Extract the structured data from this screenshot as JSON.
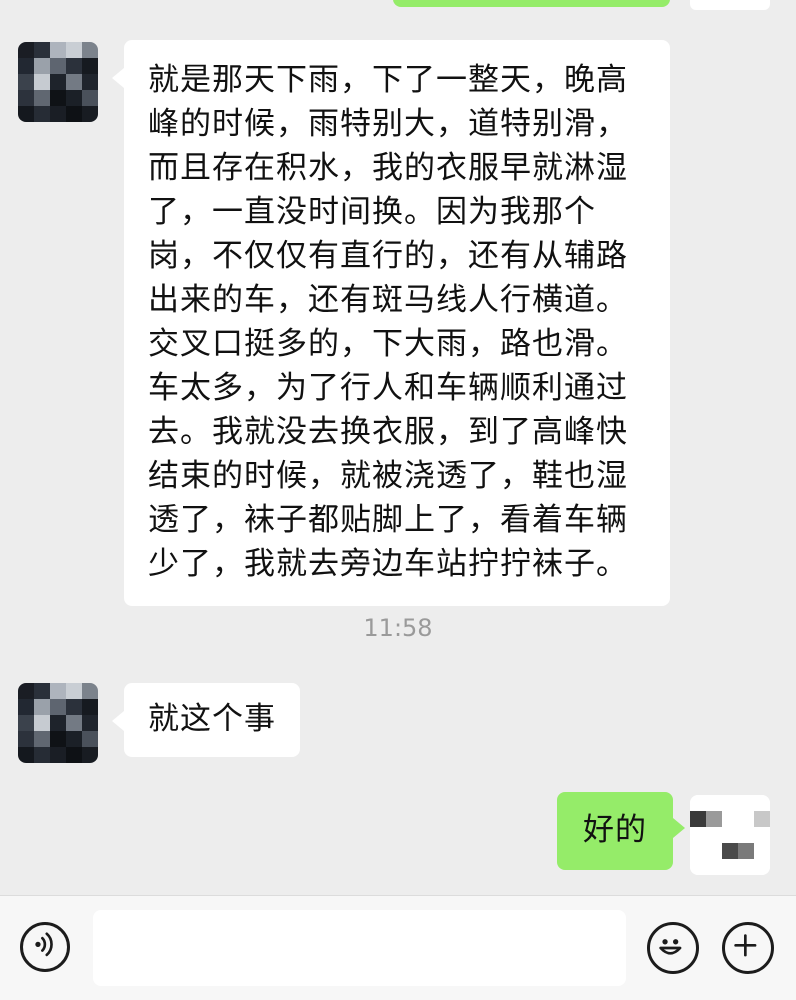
{
  "messages": [
    {
      "direction": "in",
      "lines": [
        "就是那天下雨，下了一整天，晚高",
        "峰的时候，雨特别大，道特别滑，",
        "而且存在积水，我的衣服早就淋湿",
        "了，一直没时间换。因为我那个",
        "岗，不仅仅有直行的，还有从辅路",
        "出来的车，还有斑马线人行横道。",
        "交叉口挺多的，下大雨，路也滑。",
        "车太多，为了行人和车辆顺利通过",
        "去。我就没去换衣服，到了高峰快",
        "结束的时候，就被浇透了，鞋也湿",
        "透了，袜子都贴脚上了，看着车辆",
        "少了，我就去旁边车站拧拧袜子。"
      ]
    },
    {
      "direction": "in",
      "text": "就这个事"
    },
    {
      "direction": "out",
      "text": "好的"
    }
  ],
  "timestamp": "11:58",
  "input": {
    "value": "",
    "placeholder": ""
  },
  "icons": {
    "voice": "voice-icon",
    "emoji": "emoji-icon",
    "more": "plus-icon"
  },
  "colors": {
    "background": "#ededed",
    "incoming_bubble": "#ffffff",
    "outgoing_bubble": "#95ec69",
    "timestamp": "#9a9a9a"
  }
}
